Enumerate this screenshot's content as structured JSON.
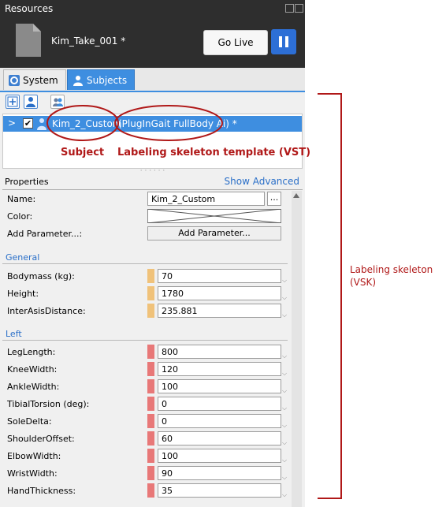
{
  "resources": {
    "title": "Resources",
    "take_name": "Kim_Take_001 *",
    "go_live_label": "Go Live"
  },
  "tabs": [
    {
      "label": "System",
      "icon": "gear-icon"
    },
    {
      "label": "Subjects",
      "icon": "person-icon",
      "active": true
    }
  ],
  "subject": {
    "expand_glyph": ">",
    "checked_glyph": "✔",
    "name": "Kim_2_Custom",
    "template": "(PlugInGait FullBody Ai) *"
  },
  "properties": {
    "title": "Properties",
    "show_advanced": "Show Advanced",
    "name_label": "Name:",
    "name_value": "Kim_2_Custom",
    "browse_label": "...",
    "color_label": "Color:",
    "add_param_label": "Add Parameter...:",
    "add_param_button": "Add Parameter...",
    "general": {
      "title": "General",
      "rows": [
        {
          "label": "Bodymass (kg):",
          "value": "70"
        },
        {
          "label": "Height:",
          "value": "1780"
        },
        {
          "label": "InterAsisDistance:",
          "value": "235.881"
        }
      ]
    },
    "left": {
      "title": "Left",
      "rows": [
        {
          "label": "LegLength:",
          "value": "800"
        },
        {
          "label": "KneeWidth:",
          "value": "120"
        },
        {
          "label": "AnkleWidth:",
          "value": "100"
        },
        {
          "label": "TibialTorsion (deg):",
          "value": "0"
        },
        {
          "label": "SoleDelta:",
          "value": "0"
        },
        {
          "label": "ShoulderOffset:",
          "value": "60"
        },
        {
          "label": "ElbowWidth:",
          "value": "100"
        },
        {
          "label": "WristWidth:",
          "value": "90"
        },
        {
          "label": "HandThickness:",
          "value": "35"
        }
      ]
    }
  },
  "annotations": {
    "subject": "Subject",
    "vst": "Labeling skeleton template (VST)",
    "vsk_line1": "Labeling skeleton",
    "vsk_line2": "(VSK)"
  },
  "colors": {
    "accent": "#3e8ee0",
    "general_swatch": "#f0c27a",
    "left_swatch": "#e87878",
    "annotation": "#b01818"
  }
}
